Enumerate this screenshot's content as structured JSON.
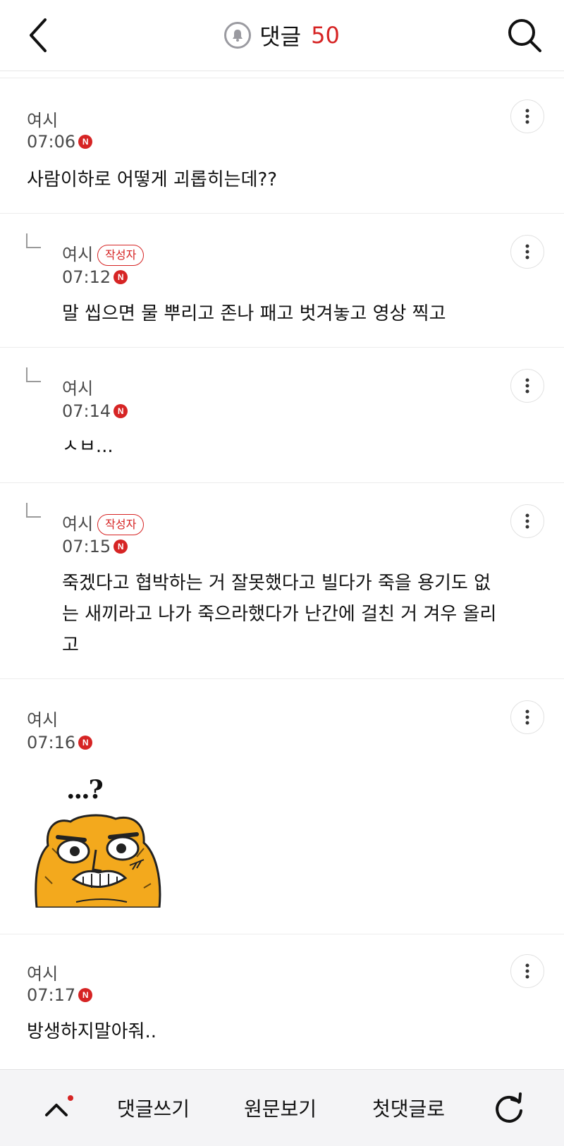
{
  "header": {
    "title": "댓글",
    "count": "50"
  },
  "comments": [
    {
      "author": "여시",
      "time": "07:06",
      "new": "N",
      "text": "사람이하로 어떻게 괴롭히는데??",
      "is_reply": false,
      "is_author": false
    },
    {
      "author": "여시",
      "badge": "작성자",
      "time": "07:12",
      "new": "N",
      "text": "말 씹으면 물 뿌리고 존나 패고 벗겨놓고 영상 찍고",
      "is_reply": true,
      "is_author": true
    },
    {
      "author": "여시",
      "time": "07:14",
      "new": "N",
      "text": "ㅅㅂ...",
      "is_reply": true,
      "is_author": false
    },
    {
      "author": "여시",
      "badge": "작성자",
      "time": "07:15",
      "new": "N",
      "text": "죽겠다고 협박하는 거 잘못했다고 빌다가 죽을 용기도 없는 새끼라고 나가 죽으라했다가 난간에 걸친 거 겨우 올리고",
      "is_reply": true,
      "is_author": true
    },
    {
      "author": "여시",
      "time": "07:16",
      "new": "N",
      "sticker": "...?",
      "is_reply": false,
      "is_author": false
    },
    {
      "author": "여시",
      "time": "07:17",
      "new": "N",
      "text": "방생하지말아줘..",
      "is_reply": false,
      "is_author": false
    }
  ],
  "bottom_bar": {
    "write": "댓글쓰기",
    "original": "원문보기",
    "first": "첫댓글로"
  },
  "icons": {
    "back": "chevron-left-icon",
    "search": "search-icon",
    "bell": "bell-icon",
    "more": "more-vertical-icon",
    "up": "chevron-up-icon",
    "refresh": "refresh-icon"
  },
  "colors": {
    "accent": "#d62424",
    "text": "#111111",
    "meta": "#4a4a4a",
    "bottom_bg": "#f4f4f6"
  }
}
